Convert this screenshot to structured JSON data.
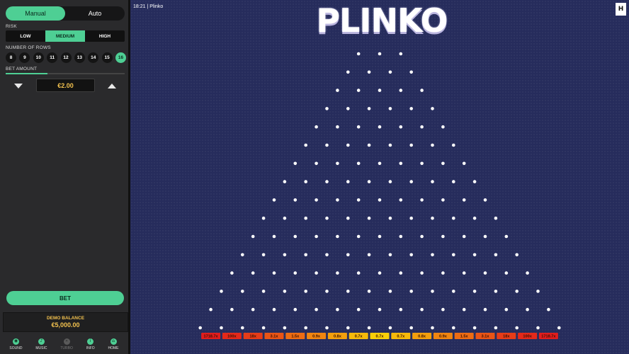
{
  "sidebar": {
    "mode": {
      "options": [
        "Manual",
        "Auto"
      ],
      "selected": "Manual"
    },
    "risk": {
      "label": "RISK",
      "options": [
        "LOW",
        "MEDIUM",
        "HIGH"
      ],
      "selected": "MEDIUM"
    },
    "rows": {
      "label": "NUMBER OF ROWS",
      "options": [
        "8",
        "9",
        "10",
        "11",
        "12",
        "13",
        "14",
        "15",
        "16"
      ],
      "selected": "16"
    },
    "bet": {
      "label": "BET AMOUNT",
      "value": "€2.00",
      "slider_fraction": 0.35
    },
    "bet_button": "BET",
    "balance": {
      "label": "DEMO BALANCE",
      "value": "€5,000.00"
    },
    "footer": [
      {
        "label": "SOUND",
        "icon": "sound-icon",
        "glyph": "◉",
        "enabled": true
      },
      {
        "label": "MUSIC",
        "icon": "music-icon",
        "glyph": "♪",
        "enabled": true
      },
      {
        "label": "TURBO",
        "icon": "turbo-icon",
        "glyph": "»",
        "enabled": false
      },
      {
        "label": "INFO",
        "icon": "info-icon",
        "glyph": "i",
        "enabled": true
      },
      {
        "label": "HOME",
        "icon": "home-icon",
        "glyph": "⌂",
        "enabled": true
      }
    ]
  },
  "game": {
    "clock": "18:21 | Plinko",
    "title": "PLINKO",
    "logo": "H",
    "board": {
      "rows": 16,
      "top_pegs": 3
    },
    "multipliers": [
      "1718.7x",
      "100x",
      "18x",
      "3.1x",
      "1.5x",
      "0.9x",
      "0.8x",
      "0.7x",
      "0.7x",
      "0.7x",
      "0.8x",
      "0.9x",
      "1.5x",
      "3.1x",
      "18x",
      "100x",
      "1718.7x"
    ],
    "multiplier_colors": [
      "#e11d1d",
      "#e4291a",
      "#e63c18",
      "#e95416",
      "#ed6c13",
      "#f08510",
      "#f39f0d",
      "#f6b90a",
      "#f9cf08",
      "#f6b90a",
      "#f39f0d",
      "#f08510",
      "#ed6c13",
      "#e95416",
      "#e63c18",
      "#e4291a",
      "#e11d1d"
    ]
  },
  "colors": {
    "accent": "#4ecf94",
    "gold": "#f2c14e",
    "board_bg": "#262c5c"
  }
}
